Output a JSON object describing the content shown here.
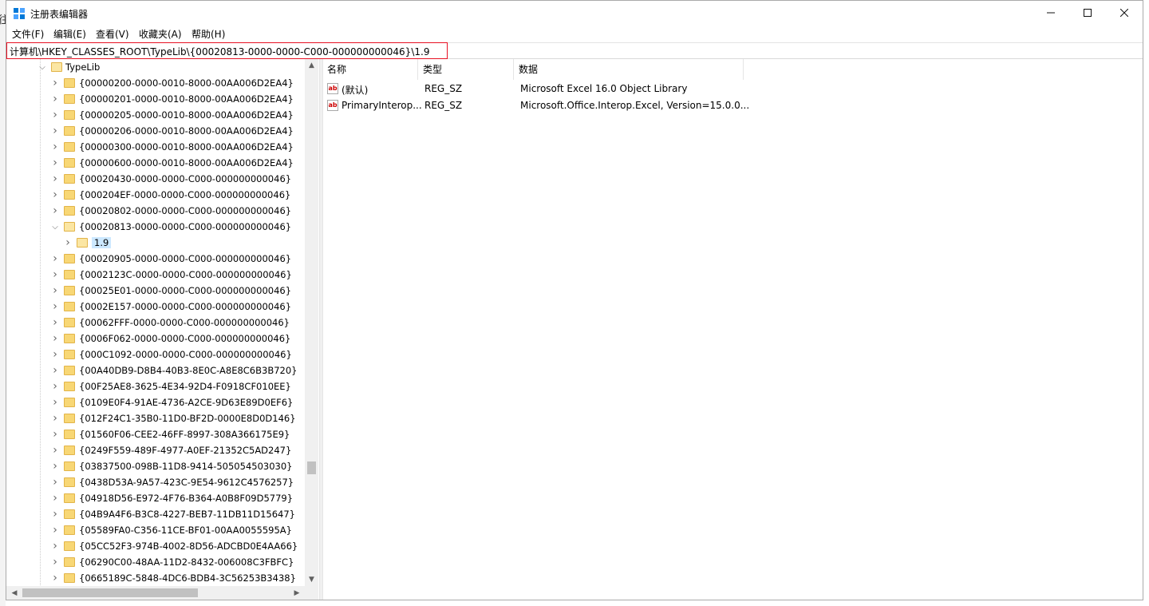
{
  "window": {
    "title": "注册表编辑器",
    "left_glyph": "往"
  },
  "menu": [
    "文件(F)",
    "编辑(E)",
    "查看(V)",
    "收藏夹(A)",
    "帮助(H)"
  ],
  "address": "计算机\\HKEY_CLASSES_ROOT\\TypeLib\\{00020813-0000-0000-C000-000000000046}\\1.9",
  "tree": {
    "root_label": "TypeLib",
    "items": [
      {
        "label": "{00000200-0000-0010-8000-00AA006D2EA4}",
        "level": 1,
        "state": "collapsed"
      },
      {
        "label": "{00000201-0000-0010-8000-00AA006D2EA4}",
        "level": 1,
        "state": "collapsed"
      },
      {
        "label": "{00000205-0000-0010-8000-00AA006D2EA4}",
        "level": 1,
        "state": "collapsed"
      },
      {
        "label": "{00000206-0000-0010-8000-00AA006D2EA4}",
        "level": 1,
        "state": "collapsed"
      },
      {
        "label": "{00000300-0000-0010-8000-00AA006D2EA4}",
        "level": 1,
        "state": "collapsed"
      },
      {
        "label": "{00000600-0000-0010-8000-00AA006D2EA4}",
        "level": 1,
        "state": "collapsed"
      },
      {
        "label": "{00020430-0000-0000-C000-000000000046}",
        "level": 1,
        "state": "collapsed"
      },
      {
        "label": "{000204EF-0000-0000-C000-000000000046}",
        "level": 1,
        "state": "collapsed"
      },
      {
        "label": "{00020802-0000-0000-C000-000000000046}",
        "level": 1,
        "state": "collapsed"
      },
      {
        "label": "{00020813-0000-0000-C000-000000000046}",
        "level": 1,
        "state": "expanded"
      },
      {
        "label": "1.9",
        "level": 2,
        "state": "selected"
      },
      {
        "label": "{00020905-0000-0000-C000-000000000046}",
        "level": 1,
        "state": "collapsed"
      },
      {
        "label": "{0002123C-0000-0000-C000-000000000046}",
        "level": 1,
        "state": "collapsed"
      },
      {
        "label": "{00025E01-0000-0000-C000-000000000046}",
        "level": 1,
        "state": "collapsed"
      },
      {
        "label": "{0002E157-0000-0000-C000-000000000046}",
        "level": 1,
        "state": "collapsed"
      },
      {
        "label": "{00062FFF-0000-0000-C000-000000000046}",
        "level": 1,
        "state": "collapsed"
      },
      {
        "label": "{0006F062-0000-0000-C000-000000000046}",
        "level": 1,
        "state": "collapsed"
      },
      {
        "label": "{000C1092-0000-0000-C000-000000000046}",
        "level": 1,
        "state": "collapsed"
      },
      {
        "label": "{00A40DB9-D8B4-40B3-8E0C-A8E8C6B3B720}",
        "level": 1,
        "state": "collapsed"
      },
      {
        "label": "{00F25AE8-3625-4E34-92D4-F0918CF010EE}",
        "level": 1,
        "state": "collapsed"
      },
      {
        "label": "{0109E0F4-91AE-4736-A2CE-9D63E89D0EF6}",
        "level": 1,
        "state": "collapsed"
      },
      {
        "label": "{012F24C1-35B0-11D0-BF2D-0000E8D0D146}",
        "level": 1,
        "state": "collapsed"
      },
      {
        "label": "{01560F06-CEE2-46FF-8997-308A366175E9}",
        "level": 1,
        "state": "collapsed"
      },
      {
        "label": "{0249F559-489F-4977-A0EF-21352C5AD247}",
        "level": 1,
        "state": "collapsed"
      },
      {
        "label": "{03837500-098B-11D8-9414-505054503030}",
        "level": 1,
        "state": "collapsed"
      },
      {
        "label": "{0438D53A-9A57-423C-9E54-9612C4576257}",
        "level": 1,
        "state": "collapsed"
      },
      {
        "label": "{04918D56-E972-4F76-B364-A0B8F09D5779}",
        "level": 1,
        "state": "collapsed"
      },
      {
        "label": "{04B9A4F6-B3C8-4227-BEB7-11DB11D15647}",
        "level": 1,
        "state": "collapsed"
      },
      {
        "label": "{05589FA0-C356-11CE-BF01-00AA0055595A}",
        "level": 1,
        "state": "collapsed"
      },
      {
        "label": "{05CC52F3-974B-4002-8D56-ADCBD0E4AA66}",
        "level": 1,
        "state": "collapsed"
      },
      {
        "label": "{06290C00-48AA-11D2-8432-006008C3FBFC}",
        "level": 1,
        "state": "collapsed"
      },
      {
        "label": "{0665189C-5848-4DC6-BDB4-3C56253B3438}",
        "level": 1,
        "state": "collapsed"
      }
    ]
  },
  "list": {
    "columns": [
      "名称",
      "类型",
      "数据"
    ],
    "rows": [
      {
        "name": "(默认)",
        "type": "REG_SZ",
        "data": "Microsoft Excel 16.0 Object Library",
        "icon": "string-value-icon"
      },
      {
        "name": "PrimaryInterop...",
        "type": "REG_SZ",
        "data": "Microsoft.Office.Interop.Excel, Version=15.0.0...",
        "icon": "string-value-icon"
      }
    ]
  },
  "colors": {
    "accent_red": "#e81123",
    "selection": "#cce8ff",
    "folder": "#f8d775",
    "window_icon": "#0078d7"
  }
}
